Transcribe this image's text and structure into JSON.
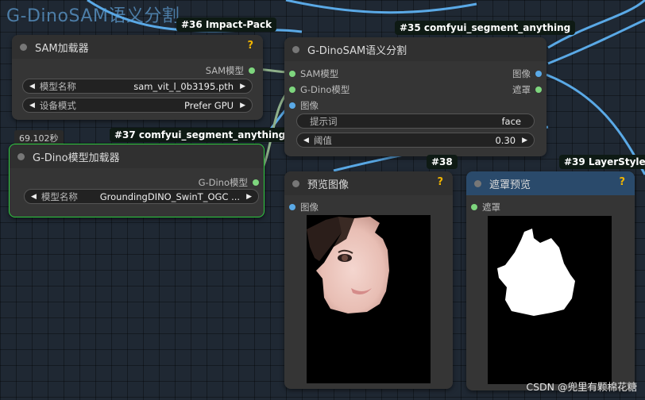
{
  "group_title": "G-DinoSAM语义分割",
  "nodes": {
    "sam_loader": {
      "badge": "#36 Impact-Pack",
      "title": "SAM加载器",
      "help": "?",
      "output": "SAM模型",
      "widgets": [
        {
          "label": "模型名称",
          "value": "sam_vit_l_0b3195.pth"
        },
        {
          "label": "设备模式",
          "value": "Prefer GPU"
        }
      ]
    },
    "gdino_loader": {
      "timer": "69.102秒",
      "badge": "#37 comfyui_segment_anything",
      "title": "G-Dino模型加载器",
      "output": "G-Dino模型",
      "widgets": [
        {
          "label": "模型名称",
          "value": "GroundingDINO_SwinT_OGC ..."
        }
      ]
    },
    "gdinosam": {
      "badge": "#35 comfyui_segment_anything",
      "title": "G-DinoSAM语义分割",
      "inputs": [
        "SAM模型",
        "G-Dino模型",
        "图像"
      ],
      "outputs": [
        "图像",
        "遮罩"
      ],
      "prompt_label": "提示词",
      "prompt_value": "face",
      "threshold_label": "阈值",
      "threshold_value": "0.30"
    },
    "preview_image": {
      "badge": "#38",
      "title": "预览图像",
      "help": "?",
      "input": "图像"
    },
    "mask_preview": {
      "badge": "#39 LayerStyle",
      "title": "遮罩预览",
      "help": "?",
      "input": "遮罩"
    }
  },
  "watermark": "CSDN @兜里有颗棉花糖",
  "colors": {
    "link_blue": "#5aa9e6",
    "link_green": "#8fb08a",
    "slot_green": "#7ed67e",
    "slot_blue": "#5aa9e6",
    "badge_green_border": "#2ecc40",
    "help_yellow": "#f0b400"
  }
}
